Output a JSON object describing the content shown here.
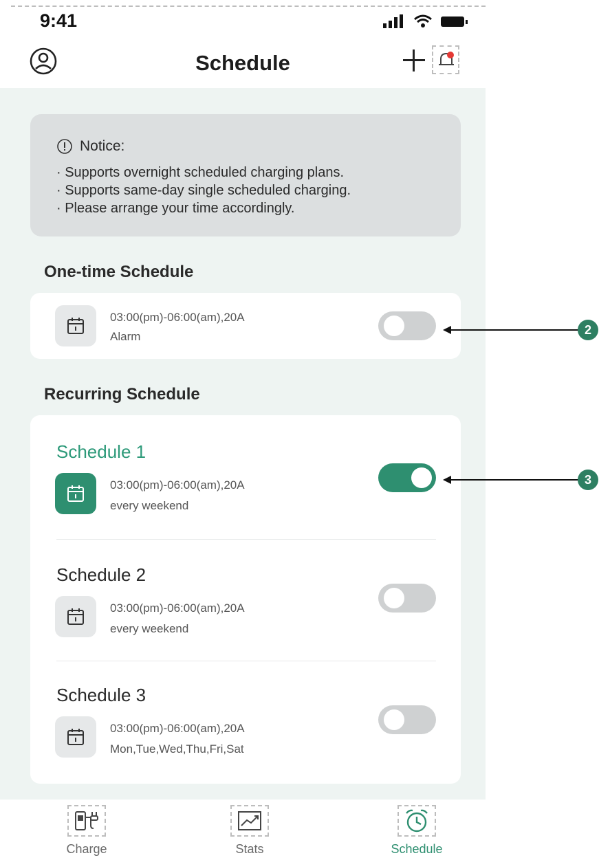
{
  "status_bar": {
    "time": "9:41"
  },
  "header": {
    "title": "Schedule"
  },
  "notice": {
    "title": "Notice:",
    "lines": [
      "· Supports overnight scheduled charging plans.",
      "· Supports same-day single scheduled charging.",
      "· Please arrange your time accordingly."
    ]
  },
  "one_time": {
    "section_title": "One-time Schedule",
    "item": {
      "time": "03:00(pm)-06:00(am),20A",
      "repeat": "Alarm",
      "enabled": false
    }
  },
  "recurring": {
    "section_title": "Recurring Schedule",
    "items": [
      {
        "name": "Schedule 1",
        "time": "03:00(pm)-06:00(am),20A",
        "repeat": "every weekend",
        "enabled": true
      },
      {
        "name": "Schedule 2",
        "time": "03:00(pm)-06:00(am),20A",
        "repeat": "every weekend",
        "enabled": false
      },
      {
        "name": "Schedule 3",
        "time": "03:00(pm)-06:00(am),20A",
        "repeat": "Mon,Tue,Wed,Thu,Fri,Sat",
        "enabled": false
      }
    ]
  },
  "tabs": [
    {
      "label": "Charge",
      "icon": "charger-icon",
      "active": false
    },
    {
      "label": "Stats",
      "icon": "chart-icon",
      "active": false
    },
    {
      "label": "Schedule",
      "icon": "alarm-clock-icon",
      "active": true
    }
  ],
  "annotations": [
    {
      "label": "2"
    },
    {
      "label": "3"
    }
  ],
  "colors": {
    "accent": "#2e8f70",
    "accent_text": "#2e9a7a",
    "background": "#eef4f2",
    "notice_bg": "#dcdfe0",
    "toggle_off": "#cfd1d2",
    "badge": "#2e7f62"
  }
}
